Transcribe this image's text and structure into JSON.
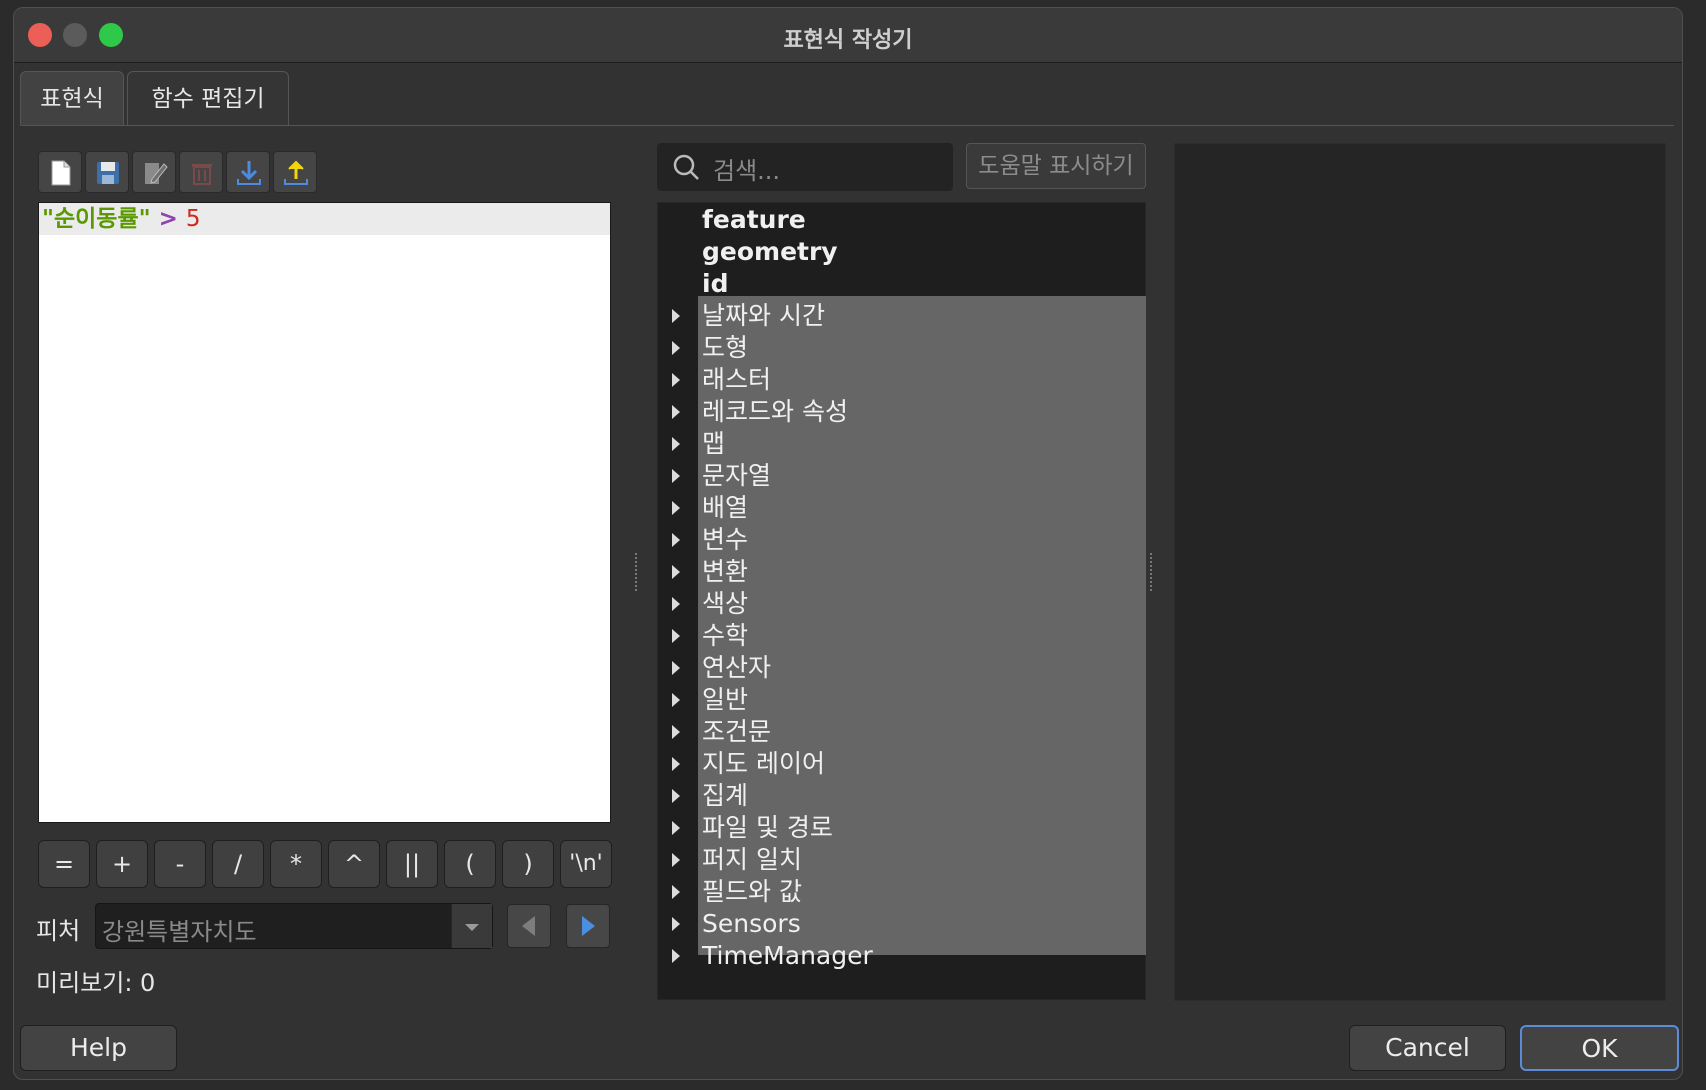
{
  "window": {
    "title": "표현식 작성기"
  },
  "tabs": [
    {
      "label": "표현식"
    },
    {
      "label": "함수 편집기"
    }
  ],
  "toolbar": {
    "icons": [
      "new-file-icon",
      "save-icon",
      "edit-icon",
      "delete-icon",
      "import-icon",
      "export-icon"
    ]
  },
  "editor": {
    "field": "\"순이동률\"",
    "operator": ">",
    "value": "5"
  },
  "operators": [
    "=",
    "+",
    "-",
    "/",
    "*",
    "^",
    "||",
    "(",
    ")",
    "'\\n'"
  ],
  "feature": {
    "label": "피처",
    "selected": "강원특별자치도"
  },
  "preview": {
    "label": "미리보기:",
    "value": "0"
  },
  "search": {
    "placeholder": "검색..."
  },
  "help_button": {
    "label": "도움말 표시하기"
  },
  "tree": {
    "top_items": [
      "feature",
      "geometry",
      "id"
    ],
    "groups": [
      "날짜와 시간",
      "도형",
      "래스터",
      "레코드와 속성",
      "맵",
      "문자열",
      "배열",
      "변수",
      "변환",
      "색상",
      "수학",
      "연산자",
      "일반",
      "조건문",
      "지도 레이어",
      "집계",
      "파일 및 경로",
      "퍼지 일치",
      "필드와 값",
      "Sensors",
      "TimeManager"
    ]
  },
  "buttons": {
    "help": "Help",
    "cancel": "Cancel",
    "ok": "OK"
  },
  "colors": {
    "field_string": "#5a9a00",
    "operator": "#8e44ad",
    "number": "#d0281e",
    "close": "#ec5f57",
    "minimize": "#5b5b5b",
    "maximize": "#2fc94a"
  }
}
